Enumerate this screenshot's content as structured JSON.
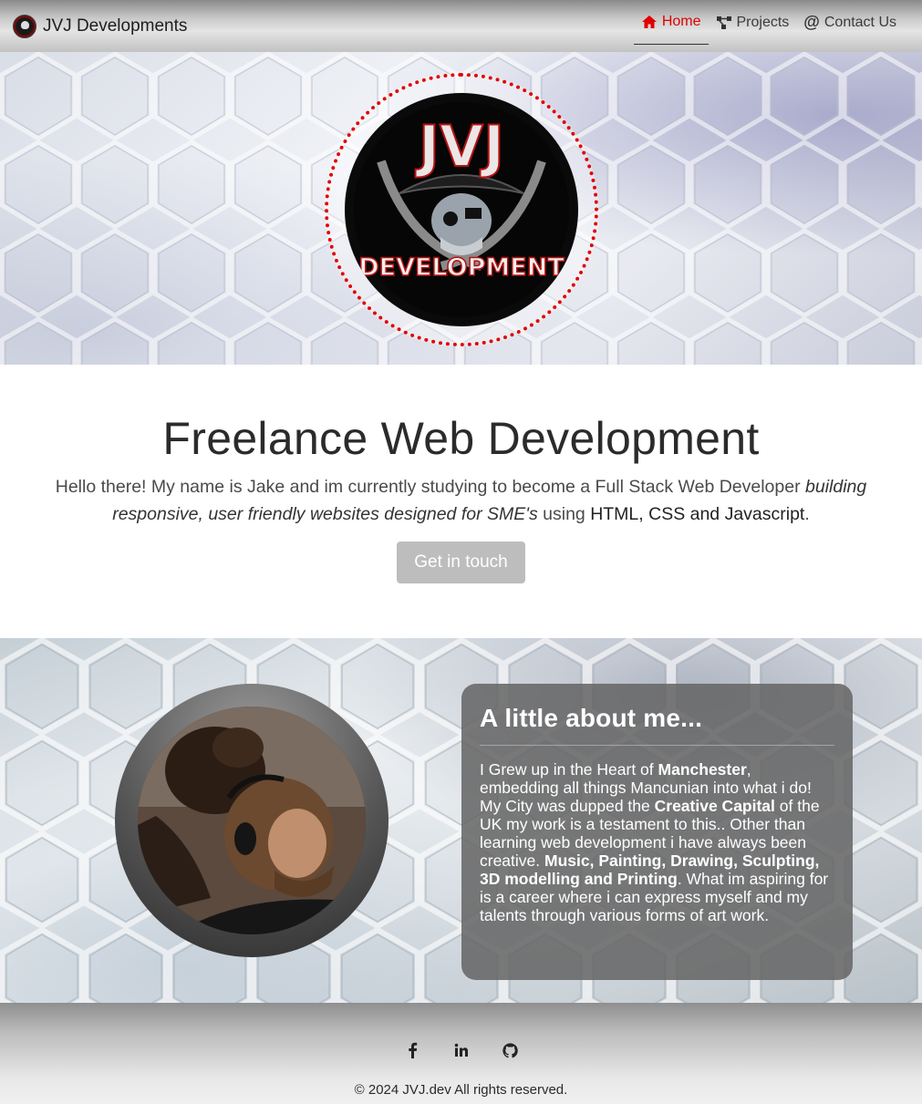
{
  "navbar": {
    "brand": "JVJ Developments",
    "items": [
      {
        "label": "Home",
        "icon": "home-icon",
        "active": true
      },
      {
        "label": "Projects",
        "icon": "projects-icon",
        "active": false
      },
      {
        "label": "Contact Us",
        "icon": "at-icon",
        "active": false
      }
    ]
  },
  "hero": {
    "logo_top": "JVJ",
    "logo_bottom": "DEVELOPMENT"
  },
  "intro": {
    "heading": "Freelance Web Development",
    "text_1": "Hello there! My name is Jake and im currently studying to become a Full Stack Web Developer ",
    "text_em": "building responsive, user friendly websites designed for SME's",
    "text_2": " using ",
    "text_tech": "HTML, CSS and Javascript",
    "text_3": ".",
    "cta": "Get in touch"
  },
  "about": {
    "heading": "A little about me...",
    "p1": "I Grew up in the Heart of ",
    "b1": "Manchester",
    "p2": ", embedding all things Mancunian into what i do! My City was dupped the ",
    "b2": "Creative Capital",
    "p3": " of the UK my work is a testament to this.. Other than learning web development i have always been creative. ",
    "b3": "Music, Painting, Drawing, Sculpting, 3D modelling and Printing",
    "p4": ". What im aspiring for is a career where i can express myself and my talents through various forms of art work."
  },
  "footer": {
    "socials": [
      "facebook-icon",
      "linkedin-icon",
      "github-icon"
    ],
    "copyright": "© 2024 JVJ.dev All rights reserved."
  },
  "colors": {
    "accent": "#e00000",
    "cta_bg": "#bdbdbd",
    "card_bg": "#646464"
  }
}
